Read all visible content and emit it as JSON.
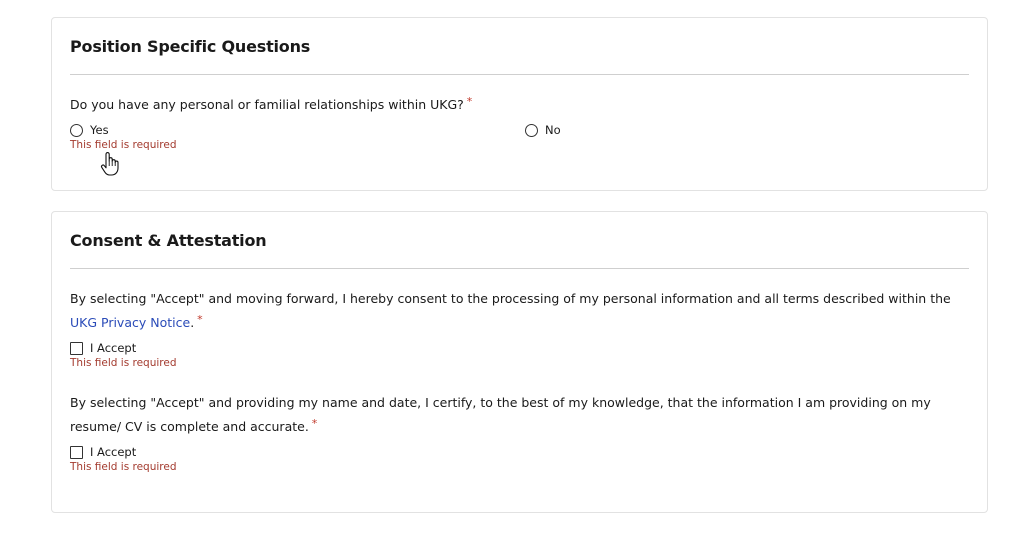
{
  "section1": {
    "title": "Position Specific Questions",
    "question": "Do you have any personal or familial relationships within UKG?",
    "required_marker": "*",
    "options": {
      "yes": "Yes",
      "no": "No"
    },
    "error": "This field is required"
  },
  "section2": {
    "title": "Consent & Attestation",
    "q1": {
      "text_before_link": "By selecting \"Accept\" and moving forward, I hereby consent to the processing of my personal information and all terms described within the ",
      "link_text": "UKG Privacy Notice",
      "text_after_link": ".",
      "required_marker": "*",
      "checkbox_label": "I Accept",
      "error": "This field is required"
    },
    "q2": {
      "text": "By selecting \"Accept\" and providing my name and date, I certify, to the best of my knowledge, that the information I am providing on my resume/ CV is complete and accurate.",
      "required_marker": "*",
      "checkbox_label": "I Accept",
      "error": "This field is required"
    }
  },
  "icons": {
    "cursor": "hand-pointer-icon"
  },
  "colors": {
    "required": "#c0392b",
    "error": "#a33a2e",
    "link": "#2a4bb8",
    "border": "#e2e2e2"
  }
}
